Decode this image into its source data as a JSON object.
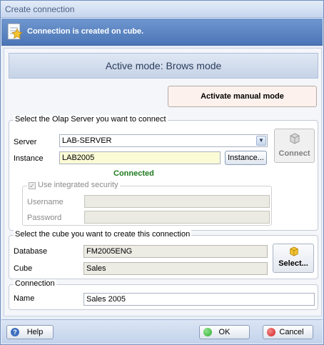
{
  "window": {
    "title": "Create connection"
  },
  "banner": {
    "message": "Connection is created on cube."
  },
  "mode": {
    "title": "Active mode: Brows mode",
    "manual_button": "Activate manual mode"
  },
  "server_group": {
    "legend": "Select the Olap Server you want to connect",
    "server_label": "Server",
    "server_value": "LAB-SERVER",
    "instance_label": "Instance",
    "instance_value": "LAB2005",
    "instance_button": "Instance...",
    "connect_button": "Connect",
    "status": "Connected",
    "security": {
      "legend": "Use integrated security",
      "checked": true,
      "username_label": "Username",
      "username_value": "",
      "password_label": "Password",
      "password_value": ""
    }
  },
  "cube_group": {
    "legend": "Select the cube you want to create this connection",
    "database_label": "Database",
    "database_value": "FM2005ENG",
    "cube_label": "Cube",
    "cube_value": "Sales",
    "select_button": "Select..."
  },
  "connection_group": {
    "legend": "Connection",
    "name_label": "Name",
    "name_value": "Sales 2005"
  },
  "footer": {
    "help": "Help",
    "ok": "OK",
    "cancel": "Cancel"
  },
  "colors": {
    "banner": "#5a82c0",
    "connected": "#1e7b1e",
    "ok_icon": "#2fae2f",
    "cancel_icon": "#d42020"
  }
}
